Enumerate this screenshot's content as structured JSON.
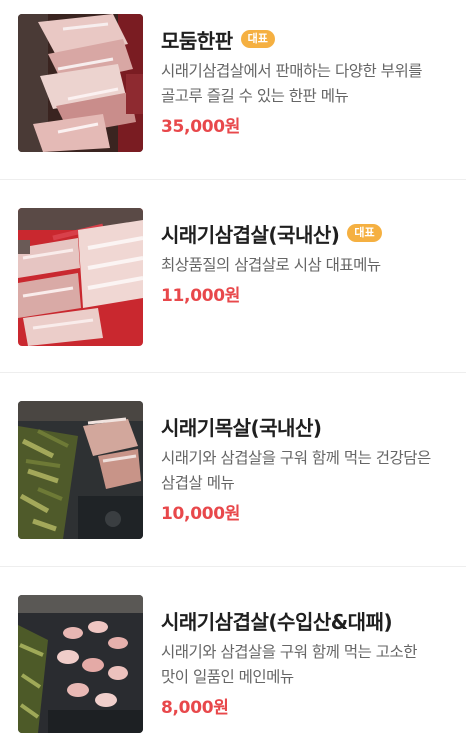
{
  "menu": {
    "items": [
      {
        "name": "모둠한판",
        "badge": "대표",
        "description": "시래기삼겹살에서 판매하는 다양한 부위를 골고루 즐길 수 있는 한판 메뉴",
        "price": "35,000원",
        "photo": "assorted-pork-platter-photo"
      },
      {
        "name": "시래기삼겹살(국내산)",
        "badge": "대표",
        "description": "최상품질의 삼겹살로 시삼 대표메뉴",
        "price": "11,000원",
        "photo": "pork-belly-tray-photo"
      },
      {
        "name": "시래기목살(국내산)",
        "description": "시래기와 삼겹살을 구워 함께 먹는 건강담은 삼겹살 메뉴",
        "price": "10,000원",
        "photo": "grilled-neck-with-greens-photo"
      },
      {
        "name": "시래기삼겹살(수입산&대패)",
        "description": "시래기와 삼겹살을 구워 함께 먹는 고소한 맛이 일품인 메인메뉴",
        "price": "8,000원",
        "photo": "rolled-pork-on-grill-photo"
      }
    ]
  },
  "colors": {
    "badge": "#f5b041",
    "price": "#e8484b",
    "description": "#666666"
  }
}
